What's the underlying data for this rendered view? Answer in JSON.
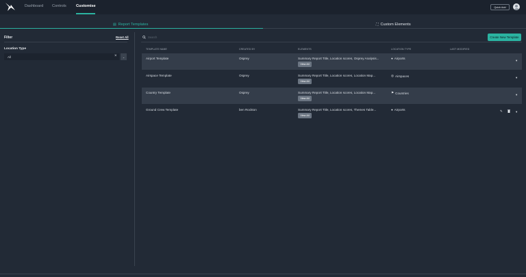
{
  "nav": {
    "items": [
      "Dashboard",
      "Controls",
      "Customise"
    ],
    "active": "Customise",
    "quick_add": "Quick Add"
  },
  "tabs": {
    "report_templates": "Report Templates",
    "custom_elements": "Custom Elements"
  },
  "filter": {
    "title": "Filter",
    "reset": "Reset All",
    "location_type_label": "Location Type",
    "location_type_value": "All"
  },
  "search": {
    "placeholder": "Search"
  },
  "create_button": "Create New Template",
  "table": {
    "headers": [
      "TEMPLATE NAME",
      "CREATED BY",
      "ELEMENTS",
      "LOCATION TYPE",
      "LAST MODIFIED"
    ],
    "view_all_label": "View All",
    "rows": [
      {
        "name": "Airport Template",
        "created_by": "Osprey",
        "elements": "Summary Report Title, Location scores, Osprey Analysis...",
        "location_type": "Airports",
        "location_icon": "map-pin-icon"
      },
      {
        "name": "Airspace Template",
        "created_by": "Osprey",
        "elements": "Summary Report Title, Location scores, Location Map...",
        "location_type": "Airspaces",
        "location_icon": "airspace-icon"
      },
      {
        "name": "Country Template",
        "created_by": "Osprey",
        "elements": "Summary Report Title, Location scores, Location Map...",
        "location_type": "Countries",
        "location_icon": "flag-icon"
      },
      {
        "name": "Ground Crew Template",
        "created_by": "ben Rockton",
        "elements": "Summary Report Title, Location scores, Themes Table...",
        "location_type": "Airports",
        "location_icon": "map-pin-icon"
      }
    ]
  },
  "colors": {
    "accent": "#2bb3a1",
    "background": "#222a36",
    "topbar": "#1b222d",
    "row_shaded": "#343d4a"
  }
}
